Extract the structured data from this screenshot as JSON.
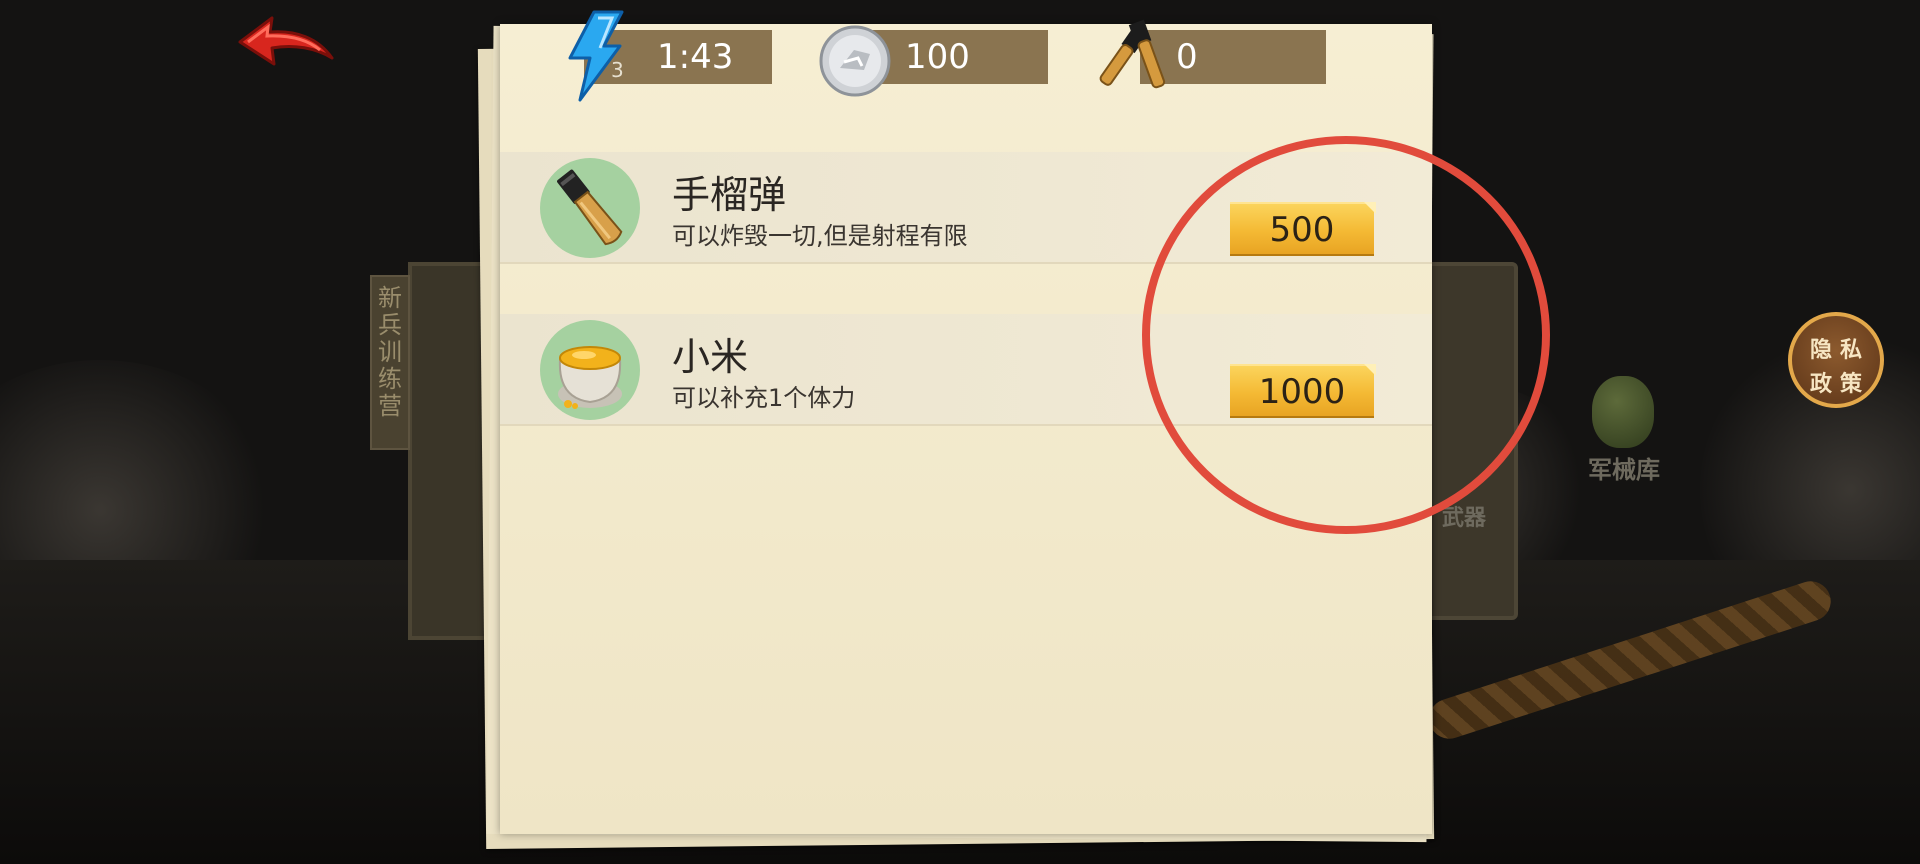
{
  "header": {
    "energy": {
      "icon": "lightning-icon",
      "count": "3",
      "timer": "1:43"
    },
    "silver": {
      "icon": "silver-coin-icon",
      "value": "100"
    },
    "grenades": {
      "icon": "grenade-icon",
      "value": "0"
    }
  },
  "shop": {
    "items": [
      {
        "name": "手榴弹",
        "description": "可以炸毁一切,但是射程有限",
        "price": "500",
        "icon": "grenade-icon"
      },
      {
        "name": "小米",
        "description": "可以补充1个体力",
        "price": "1000",
        "icon": "millet-sack-icon"
      }
    ]
  },
  "background": {
    "banner": [
      "新",
      "兵",
      "训",
      "练",
      "营"
    ],
    "armory_label": "军械库",
    "partial_label": "武器"
  },
  "privacy": {
    "line1": "隐私",
    "line2": "政策"
  },
  "colors": {
    "annotation": "#e14b3c",
    "price_gold": "#f4b934",
    "paper": "#f4ecd0",
    "resource_bar": "#8a7450"
  }
}
